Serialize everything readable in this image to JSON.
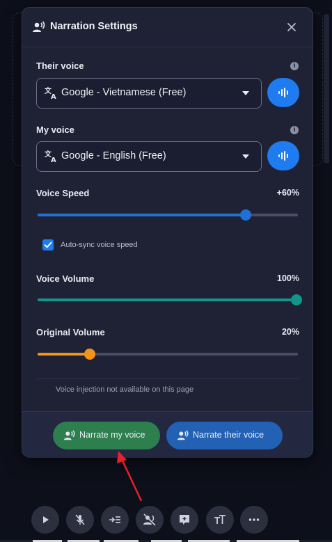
{
  "header": {
    "title": "Narration Settings",
    "title_icon": "voice-person-icon",
    "close_icon": "close-icon"
  },
  "their_voice": {
    "label": "Their voice",
    "selected": "Google - Vietnamese (Free)",
    "icon": "translate-icon",
    "button_icon": "audio-wave-icon"
  },
  "my_voice": {
    "label": "My voice",
    "selected": "Google - English (Free)",
    "icon": "translate-icon",
    "button_icon": "audio-wave-icon"
  },
  "voice_speed": {
    "label": "Voice Speed",
    "value_text": "+60%",
    "level": 0.8,
    "color": "#1e72d6"
  },
  "auto_sync": {
    "label": "Auto-sync voice speed",
    "checked": true
  },
  "voice_volume": {
    "label": "Voice Volume",
    "value_text": "100%",
    "level": 1.0,
    "color": "#13958a"
  },
  "original_volume": {
    "label": "Original Volume",
    "value_text": "20%",
    "level": 0.2,
    "color": "#f0941c"
  },
  "note": "Voice injection not available on this page",
  "footer": {
    "narrate_mine": {
      "label": "Narrate my voice",
      "color": "#2d7f4e"
    },
    "narrate_theirs": {
      "label": "Narrate their voice",
      "color": "#2361b5"
    }
  },
  "toolbar": {
    "buttons": [
      "play-icon",
      "mic-off-icon",
      "indent-icon",
      "voice-off-icon",
      "add-comment-icon",
      "text-size-icon",
      "more-icon"
    ]
  },
  "colors": {
    "accent_blue": "#1e7bf0",
    "annotation_arrow": "#e8202a"
  }
}
